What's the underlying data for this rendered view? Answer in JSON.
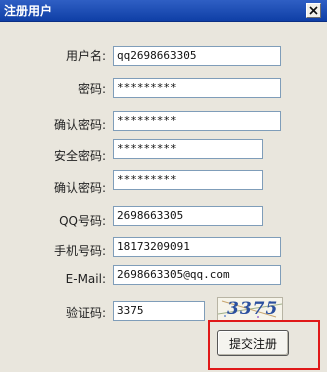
{
  "window": {
    "title": "注册用户",
    "close_icon": "close-icon"
  },
  "form": {
    "fields": [
      {
        "label": "用户名:",
        "value": "qq2698663305"
      },
      {
        "label": "密码:",
        "value": "*********"
      },
      {
        "label": "确认密码:",
        "value": "*********"
      },
      {
        "label": "安全密码:",
        "value": "*********"
      },
      {
        "label": "确认密码:",
        "value": "*********"
      },
      {
        "label": "QQ号码:",
        "value": "2698663305"
      },
      {
        "label": "手机号码:",
        "value": "18173209091"
      },
      {
        "label": "E-Mail:",
        "value": "2698663305@qq.com"
      },
      {
        "label": "验证码:",
        "value": "3375"
      }
    ],
    "captcha_image_text": "3375",
    "submit_label": "提交注册"
  },
  "colors": {
    "titlebar": "#1a4bb4",
    "window_bg": "#e9e6dd",
    "input_border": "#7f9db9",
    "highlight": "#e01818"
  }
}
